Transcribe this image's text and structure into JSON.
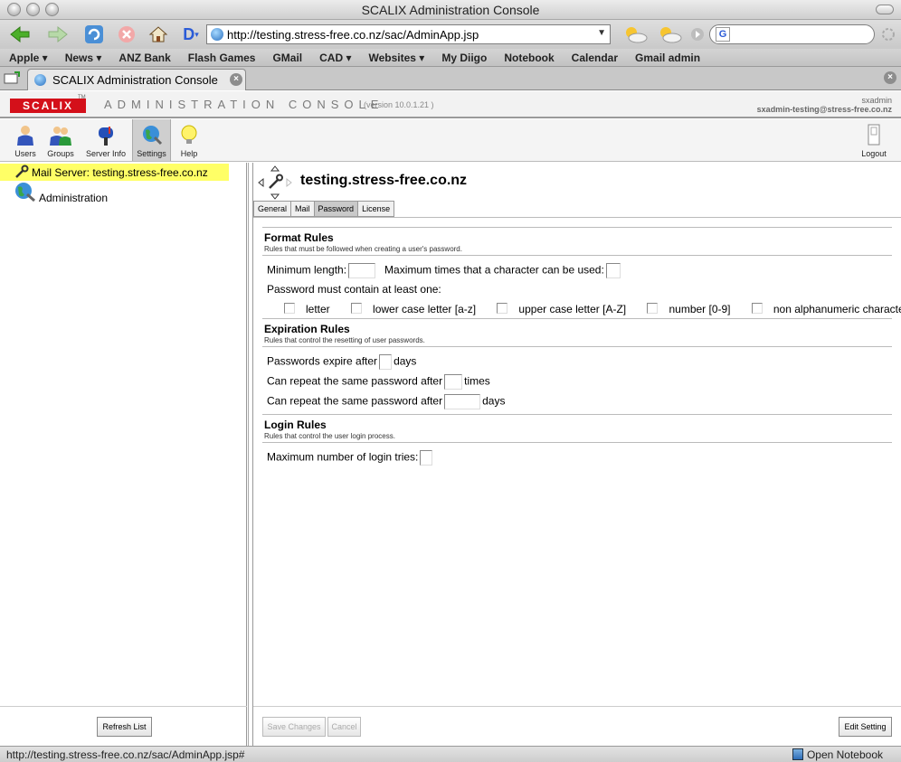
{
  "window": {
    "title": "SCALIX Administration Console"
  },
  "nav": {
    "url": "http://testing.stress-free.co.nz/sac/AdminApp.jsp"
  },
  "bookmarks": [
    "Apple ▾",
    "News ▾",
    "ANZ Bank",
    "Flash Games",
    "GMail",
    "CAD ▾",
    "Websites ▾",
    "My Diigo",
    "Notebook",
    "Calendar",
    "Gmail admin"
  ],
  "tab": {
    "title": "SCALIX Administration Console"
  },
  "header": {
    "logo": "SCALIX",
    "tm": "TM",
    "console": "ADMINISTRATION CONSOLE",
    "version": "(version 10.0.1.21 )",
    "user": "sxadmin",
    "email": "sxadmin-testing@stress-free.co.nz"
  },
  "toolbar": {
    "users": "Users",
    "groups": "Groups",
    "server_info": "Server Info",
    "settings": "Settings",
    "help": "Help",
    "logout": "Logout"
  },
  "tree": {
    "mail_server": "Mail Server: testing.stress-free.co.nz",
    "administration": "Administration"
  },
  "left_footer": {
    "refresh": "Refresh List"
  },
  "server": {
    "title": "testing.stress-free.co.nz"
  },
  "tabs": [
    "General",
    "Mail",
    "Password",
    "License"
  ],
  "format_rules": {
    "heading": "Format Rules",
    "desc": "Rules that must be followed when creating a user's password.",
    "min_length": "Minimum length:",
    "max_times": "Maximum times that a character can be used:",
    "must_contain": "Password must contain at least one:",
    "options": [
      "letter",
      "lower case letter [a-z]",
      "upper case letter [A-Z]",
      "number [0-9]",
      "non alphanumeric character"
    ]
  },
  "expiration_rules": {
    "heading": "Expiration Rules",
    "desc": "Rules that control the resetting of user passwords.",
    "expire_pre": "Passwords expire after",
    "expire_post": "days",
    "repeat_pre": "Can repeat the same password after",
    "repeat_times": "times",
    "repeat_days": "days"
  },
  "login_rules": {
    "heading": "Login Rules",
    "desc": "Rules that control the user login process.",
    "max_tries": "Maximum number of login tries:"
  },
  "actions": {
    "save": "Save Changes",
    "cancel": "Cancel",
    "edit": "Edit Setting"
  },
  "status": {
    "text": "http://testing.stress-free.co.nz/sac/AdminApp.jsp#",
    "notebook": "Open Notebook"
  }
}
